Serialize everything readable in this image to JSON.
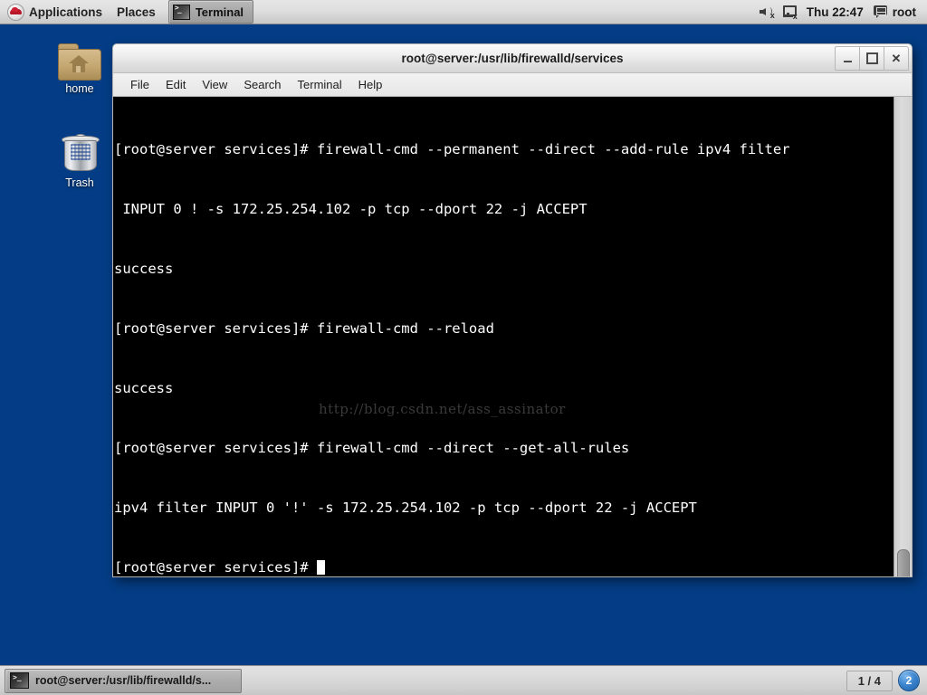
{
  "top_panel": {
    "applications_label": "Applications",
    "places_label": "Places",
    "logo_icon": "redhat-logo-icon",
    "task_label": "Terminal",
    "task_icon": "terminal-icon",
    "volume_icon": "volume-muted-icon",
    "network_icon": "network-disconnected-icon",
    "clock": "Thu 22:47",
    "user_icon": "message-icon",
    "user_label": "root"
  },
  "desktop": {
    "background_color": "#043d85",
    "icons": [
      {
        "label": "home",
        "icon": "home-folder-icon"
      },
      {
        "label": "Trash",
        "icon": "trash-icon"
      }
    ]
  },
  "window": {
    "title": "root@server:/usr/lib/firewalld/services",
    "buttons": {
      "minimize": "minimize-icon",
      "maximize": "maximize-icon",
      "close": "close-icon"
    },
    "menu": [
      "File",
      "Edit",
      "View",
      "Search",
      "Terminal",
      "Help"
    ],
    "terminal": {
      "background_color": "#000000",
      "foreground_color": "#ffffff",
      "lines": [
        "[root@server services]# firewall-cmd --permanent --direct --add-rule ipv4 filter",
        " INPUT 0 ! -s 172.25.254.102 -p tcp --dport 22 -j ACCEPT",
        "success",
        "[root@server services]# firewall-cmd --reload",
        "success",
        "[root@server services]# firewall-cmd --direct --get-all-rules",
        "ipv4 filter INPUT 0 '!' -s 172.25.254.102 -p tcp --dport 22 -j ACCEPT"
      ],
      "prompt": "[root@server services]# ",
      "watermark": "http://blog.csdn.net/ass_assinator"
    }
  },
  "bottom_panel": {
    "task_label": "root@server:/usr/lib/firewalld/s...",
    "task_icon": "terminal-icon",
    "workspace_indicator": "1 / 4",
    "notification_count": "2"
  }
}
